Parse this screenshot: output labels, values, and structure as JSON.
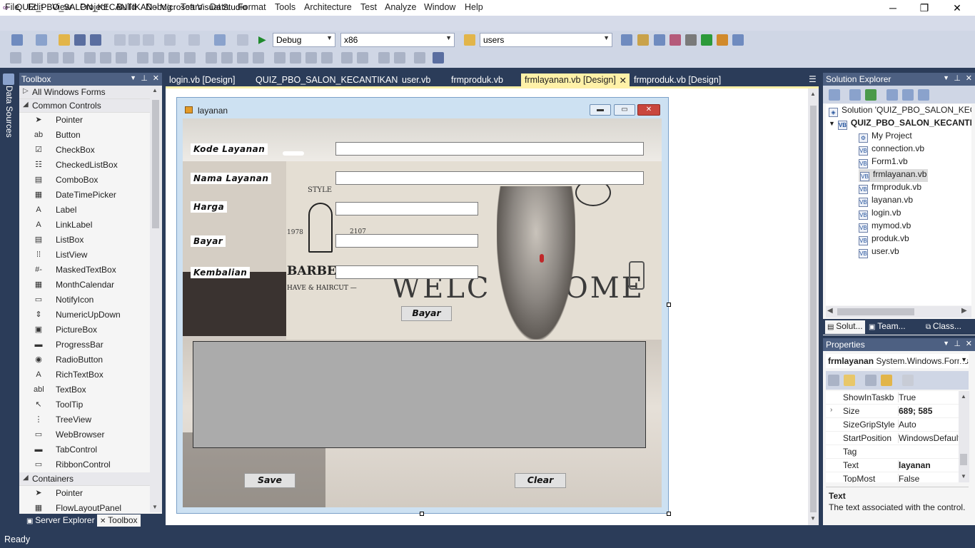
{
  "window": {
    "title": "QUIZ_PBO_SALON_KECANTIKAN - Microsoft Visual Studio",
    "icon": "infinity-logo-icon",
    "minimize": "─",
    "restore": "❐",
    "close": "✕"
  },
  "menu": [
    "File",
    "Edit",
    "View",
    "Project",
    "Build",
    "Debug",
    "Team",
    "Data",
    "Format",
    "Tools",
    "Architecture",
    "Test",
    "Analyze",
    "Window",
    "Help"
  ],
  "toolbar": {
    "config": "Debug",
    "platform": "x86",
    "search": "users"
  },
  "side_strip": {
    "label": "Data Sources"
  },
  "toolbox": {
    "title": "Toolbox",
    "groups": [
      {
        "label": "All Windows Forms",
        "expanded": false,
        "items": []
      },
      {
        "label": "Common Controls",
        "expanded": true,
        "items": [
          {
            "label": "Pointer",
            "icon": "pointer-icon",
            "glyph": "➤"
          },
          {
            "label": "Button",
            "icon": "button-icon",
            "glyph": "ab"
          },
          {
            "label": "CheckBox",
            "icon": "checkbox-icon",
            "glyph": "☑"
          },
          {
            "label": "CheckedListBox",
            "icon": "checkedlistbox-icon",
            "glyph": "☷"
          },
          {
            "label": "ComboBox",
            "icon": "combobox-icon",
            "glyph": "▤"
          },
          {
            "label": "DateTimePicker",
            "icon": "datetimepicker-icon",
            "glyph": "▦"
          },
          {
            "label": "Label",
            "icon": "label-icon",
            "glyph": "A"
          },
          {
            "label": "LinkLabel",
            "icon": "linklabel-icon",
            "glyph": "A"
          },
          {
            "label": "ListBox",
            "icon": "listbox-icon",
            "glyph": "▤"
          },
          {
            "label": "ListView",
            "icon": "listview-icon",
            "glyph": "⁞⁞"
          },
          {
            "label": "MaskedTextBox",
            "icon": "maskedtextbox-icon",
            "glyph": "#-"
          },
          {
            "label": "MonthCalendar",
            "icon": "monthcalendar-icon",
            "glyph": "▦"
          },
          {
            "label": "NotifyIcon",
            "icon": "notifyicon-icon",
            "glyph": "▭"
          },
          {
            "label": "NumericUpDown",
            "icon": "numericupdown-icon",
            "glyph": "⇕"
          },
          {
            "label": "PictureBox",
            "icon": "picturebox-icon",
            "glyph": "▣"
          },
          {
            "label": "ProgressBar",
            "icon": "progressbar-icon",
            "glyph": "▬"
          },
          {
            "label": "RadioButton",
            "icon": "radiobutton-icon",
            "glyph": "◉"
          },
          {
            "label": "RichTextBox",
            "icon": "richtextbox-icon",
            "glyph": "A"
          },
          {
            "label": "TextBox",
            "icon": "textbox-icon",
            "glyph": "abl"
          },
          {
            "label": "ToolTip",
            "icon": "tooltip-icon",
            "glyph": "↖"
          },
          {
            "label": "TreeView",
            "icon": "treeview-icon",
            "glyph": "⋮"
          },
          {
            "label": "WebBrowser",
            "icon": "webbrowser-icon",
            "glyph": "▭"
          },
          {
            "label": "TabControl",
            "icon": "tabcontrol-icon",
            "glyph": "▬"
          },
          {
            "label": "RibbonControl",
            "icon": "ribboncontrol-icon",
            "glyph": "▭"
          }
        ]
      },
      {
        "label": "Containers",
        "expanded": true,
        "items": [
          {
            "label": "Pointer",
            "icon": "pointer-icon",
            "glyph": "➤"
          },
          {
            "label": "FlowLayoutPanel",
            "icon": "flowlayoutpanel-icon",
            "glyph": "▦"
          }
        ]
      }
    ],
    "bottom_tabs": [
      "Server Explorer",
      "Toolbox"
    ]
  },
  "doc_tabs": [
    {
      "label": "login.vb [Design]",
      "active": false
    },
    {
      "label": "QUIZ_PBO_SALON_KECANTIKAN",
      "active": false
    },
    {
      "label": "user.vb",
      "active": false
    },
    {
      "label": "frmproduk.vb",
      "active": false
    },
    {
      "label": "frmlayanan.vb [Design]",
      "active": true
    },
    {
      "label": "frmproduk.vb [Design]",
      "active": false
    }
  ],
  "form": {
    "title": "layanan",
    "labels": {
      "kode": "Kode Layanan",
      "nama": "Nama Layanan",
      "harga": "Harga",
      "bayar": "Bayar",
      "kembalian": "Kembalian"
    },
    "buttons": {
      "bayar": "Bayar",
      "save": "Save",
      "clear": "Clear"
    },
    "background_text": {
      "style": "STYLE",
      "year1": "1978",
      "year2": "2107",
      "barber": "BARBER",
      "shave": "HAVE & HAIRCUT —",
      "welc": "WELC",
      "ome": "OME"
    }
  },
  "solution_explorer": {
    "title": "Solution Explorer",
    "solution": "Solution 'QUIZ_PBO_SALON_KECANTIKAN'",
    "project": "QUIZ_PBO_SALON_KECANTIKAN",
    "items": [
      "My Project",
      "connection.vb",
      "Form1.vb",
      "frmlayanan.vb",
      "frmproduk.vb",
      "layanan.vb",
      "login.vb",
      "mymod.vb",
      "produk.vb",
      "user.vb"
    ],
    "selected": "frmlayanan.vb",
    "tabs": [
      "Solut...",
      "Team...",
      "Class..."
    ]
  },
  "properties": {
    "title": "Properties",
    "object_name": "frmlayanan",
    "object_type": "System.Windows.Forms.Form",
    "rows": [
      {
        "name": "ShowInTaskbar",
        "value": "True",
        "bold": false,
        "expand": false
      },
      {
        "name": "Size",
        "value": "689; 585",
        "bold": true,
        "expand": true
      },
      {
        "name": "SizeGripStyle",
        "value": "Auto",
        "bold": false,
        "expand": false
      },
      {
        "name": "StartPosition",
        "value": "WindowsDefaultLocation",
        "bold": false,
        "expand": false
      },
      {
        "name": "Tag",
        "value": "",
        "bold": false,
        "expand": false
      },
      {
        "name": "Text",
        "value": "layanan",
        "bold": true,
        "expand": false
      },
      {
        "name": "TopMost",
        "value": "False",
        "bold": false,
        "expand": false
      }
    ],
    "desc_title": "Text",
    "desc_body": "The text associated with the control."
  },
  "status": {
    "text": "Ready"
  },
  "colors": {
    "chrome_dark": "#2b3c59",
    "active_tab": "#fff1a8",
    "panel_header": "#4d6082"
  }
}
